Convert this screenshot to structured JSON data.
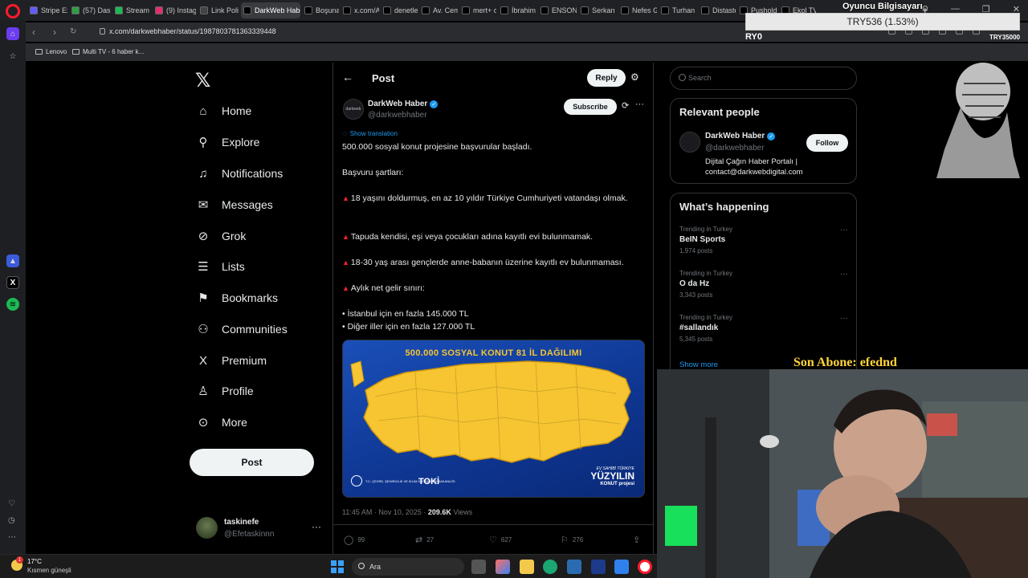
{
  "browser": {
    "tabs": [
      {
        "label": "Stripe Ex",
        "color": "#635bff"
      },
      {
        "label": "(57) Das",
        "color": "#2f9e44"
      },
      {
        "label": "Stream",
        "color": "#1db954"
      },
      {
        "label": "(9) Instag",
        "color": "#e1306c"
      },
      {
        "label": "Link Poli",
        "color": "#444"
      },
      {
        "label": "DarkWeb Habe",
        "color": "#000"
      },
      {
        "label": "Boşuna",
        "color": "#000"
      },
      {
        "label": "x.com/Ar",
        "color": "#000"
      },
      {
        "label": "denetle",
        "color": "#000"
      },
      {
        "label": "Av. Cem",
        "color": "#000"
      },
      {
        "label": "mert+ o",
        "color": "#000"
      },
      {
        "label": "İbrahim",
        "color": "#000"
      },
      {
        "label": "ENSONI",
        "color": "#000"
      },
      {
        "label": "Serkan T",
        "color": "#000"
      },
      {
        "label": "Nefes Ge",
        "color": "#000"
      },
      {
        "label": "Turhan E",
        "color": "#000"
      },
      {
        "label": "Distaste",
        "color": "#000"
      },
      {
        "label": "Pusholdi",
        "color": "#000"
      },
      {
        "label": "Ekol TV",
        "color": "#000"
      }
    ],
    "url": "x.com/darkwebhaber/status/1987803781363339448",
    "bookmarks": [
      "Lenovo",
      "Multi TV - 6 haber k..."
    ]
  },
  "nav": {
    "items": [
      {
        "label": "Home",
        "icon": "home-icon",
        "glyph": "⌂"
      },
      {
        "label": "Explore",
        "icon": "search-icon",
        "glyph": "⚲"
      },
      {
        "label": "Notifications",
        "icon": "bell-icon",
        "glyph": "♫"
      },
      {
        "label": "Messages",
        "icon": "envelope-icon",
        "glyph": "✉"
      },
      {
        "label": "Grok",
        "icon": "grok-icon",
        "glyph": "⊘"
      },
      {
        "label": "Lists",
        "icon": "list-icon",
        "glyph": "☰"
      },
      {
        "label": "Bookmarks",
        "icon": "bookmark-icon",
        "glyph": "⚑"
      },
      {
        "label": "Communities",
        "icon": "people-icon",
        "glyph": "⚇"
      },
      {
        "label": "Premium",
        "icon": "x-icon",
        "glyph": "X"
      },
      {
        "label": "Profile",
        "icon": "person-icon",
        "glyph": "♙"
      },
      {
        "label": "More",
        "icon": "more-circle-icon",
        "glyph": "⊙"
      }
    ],
    "post_button": "Post",
    "account": {
      "name": "taskinefe",
      "handle": "@Efetaskinnn"
    }
  },
  "post": {
    "header_title": "Post",
    "reply_button": "Reply",
    "author": {
      "name": "DarkWeb Haber",
      "handle": "@darkwebhaber",
      "avatar_text": "darkweb"
    },
    "subscribe_button": "Subscribe",
    "show_translation": "Show translation",
    "lines": [
      {
        "text": "500.000 sosyal konut projesine başvurular başladı.",
        "bullet": ""
      },
      {
        "text": "Başvuru şartları:",
        "bullet": ""
      },
      {
        "text": "18 yaşını doldurmuş, en az 10 yıldır Türkiye Cumhuriyeti vatandaşı olmak.",
        "bullet": "▲"
      },
      {
        "text": "Tapuda kendisi, eşi veya çocukları adına kayıtlı evi bulunmamak.",
        "bullet": "▲"
      },
      {
        "text": "18-30 yaş arası gençlerde anne-babanın üzerine kayıtlı ev bulunmaması.",
        "bullet": "▲"
      },
      {
        "text": "Aylık net gelir sınırı:",
        "bullet": "▲"
      },
      {
        "text": "• İstanbul için en fazla 145.000 TL",
        "bullet": ""
      },
      {
        "text": "• Diğer iller için en fazla 127.000 TL",
        "bullet": ""
      }
    ],
    "image": {
      "title": "500.000 SOSYAL KONUT 81 İL DAĞILIMI",
      "ministry": "T.C. ÇEVRE, ŞEHİRCİLİK VE İKLİM DEĞİŞİKLİĞİ BAKANLIĞI",
      "toki": "TOKİ",
      "slogan_line1": "EV SAHİBİ TÜRKİYE",
      "slogan_line2": "YÜZYILIN",
      "slogan_line3": "KONUT projesi",
      "map_color": "#f6c531"
    },
    "time": "11:45 AM · Nov 10, 2025 · ",
    "views_count": "209.6K",
    "views_label": " Views",
    "stats": {
      "replies": "99",
      "reposts": "27",
      "likes": "627",
      "bookmarks": "276"
    }
  },
  "sidebar": {
    "search_placeholder": "Search",
    "relevant_title": "Relevant people",
    "person": {
      "name": "DarkWeb Haber",
      "handle": "@darkwebhaber",
      "bio_line1": "Dijital Çağın Haber Portalı |",
      "bio_line2": "contact@darkwebdigital.com",
      "follow_button": "Follow"
    },
    "happening_title": "What’s happening",
    "trends": [
      {
        "context": "Trending in Turkey",
        "title": "BeIN Sports",
        "count": "1,974 posts"
      },
      {
        "context": "Trending in Turkey",
        "title": "O da Hz",
        "count": "3,343 posts"
      },
      {
        "context": "Trending in Turkey",
        "title": "#sallandık",
        "count": "5,345 posts"
      }
    ],
    "show_more": "Show more"
  },
  "overlay": {
    "player_label": "Oyuncu Bilgisayarı",
    "price": "TRY536 (1.53%)",
    "ticker_left": "RY0",
    "ticker_right": "TRY35000",
    "last_sub": "Son Abone: efednd"
  },
  "taskbar": {
    "temp": "17°C",
    "weather": "Kısmen güneşli",
    "badge": "1",
    "search": "Ara"
  }
}
